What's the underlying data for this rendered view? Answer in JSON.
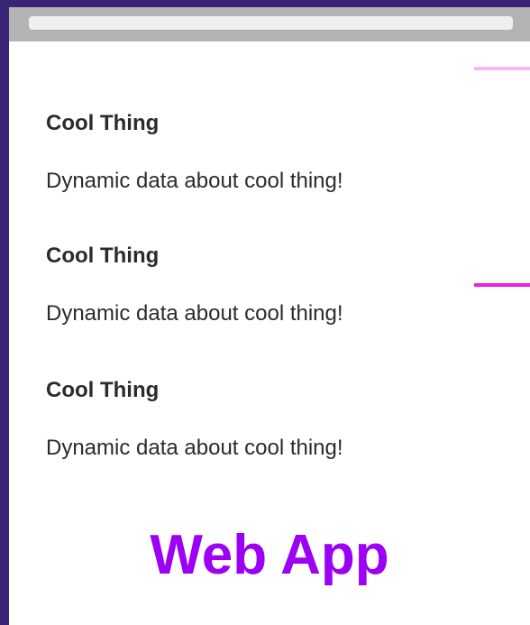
{
  "colors": {
    "background": "#3a2475",
    "window": "#ffffff",
    "titlebar": "#b3b3b3",
    "address_bar": "#efefef",
    "text": "#2b2b2b",
    "accent_light": "#f7b8ef",
    "accent_strong": "#f21ce0",
    "app_title": "#9b00f5"
  },
  "cards": [
    {
      "title": "Cool Thing",
      "description": "Dynamic data about cool thing!"
    },
    {
      "title": "Cool Thing",
      "description": "Dynamic data about cool thing!"
    },
    {
      "title": "Cool Thing",
      "description": "Dynamic data about cool thing!"
    }
  ],
  "app_title": "Web App"
}
